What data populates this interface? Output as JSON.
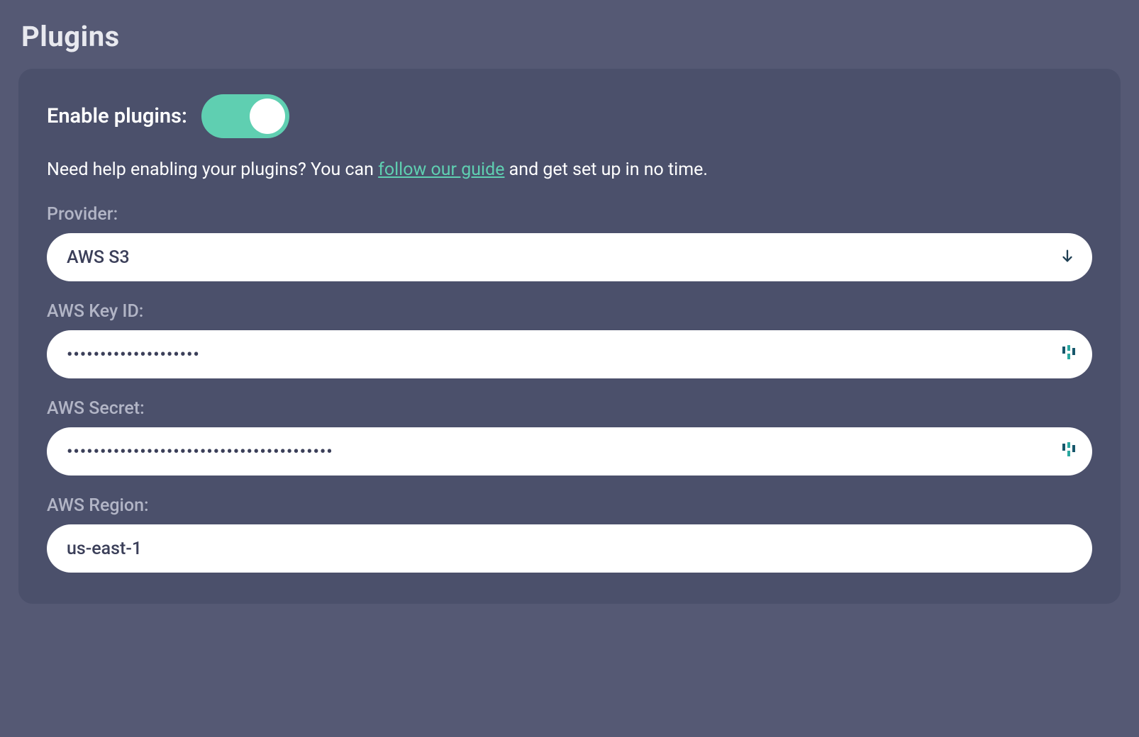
{
  "page": {
    "title": "Plugins"
  },
  "plugins": {
    "enable_label": "Enable plugins:",
    "enabled": true,
    "help_prefix": "Need help enabling your plugins? You can ",
    "help_link_text": "follow our guide",
    "help_suffix": " and get set up in no time."
  },
  "form": {
    "provider": {
      "label": "Provider:",
      "value": "AWS S3"
    },
    "aws_key_id": {
      "label": "AWS Key ID:",
      "value": "••••••••••••••••••••"
    },
    "aws_secret": {
      "label": "AWS Secret:",
      "value": "••••••••••••••••••••••••••••••••••••••••"
    },
    "aws_region": {
      "label": "AWS Region:",
      "value": "us-east-1"
    }
  },
  "colors": {
    "accent": "#5fcfb1",
    "body_bg": "#555974",
    "card_bg": "#4b506b",
    "label": "#b2b5c6",
    "input_text": "#3b3f59"
  }
}
